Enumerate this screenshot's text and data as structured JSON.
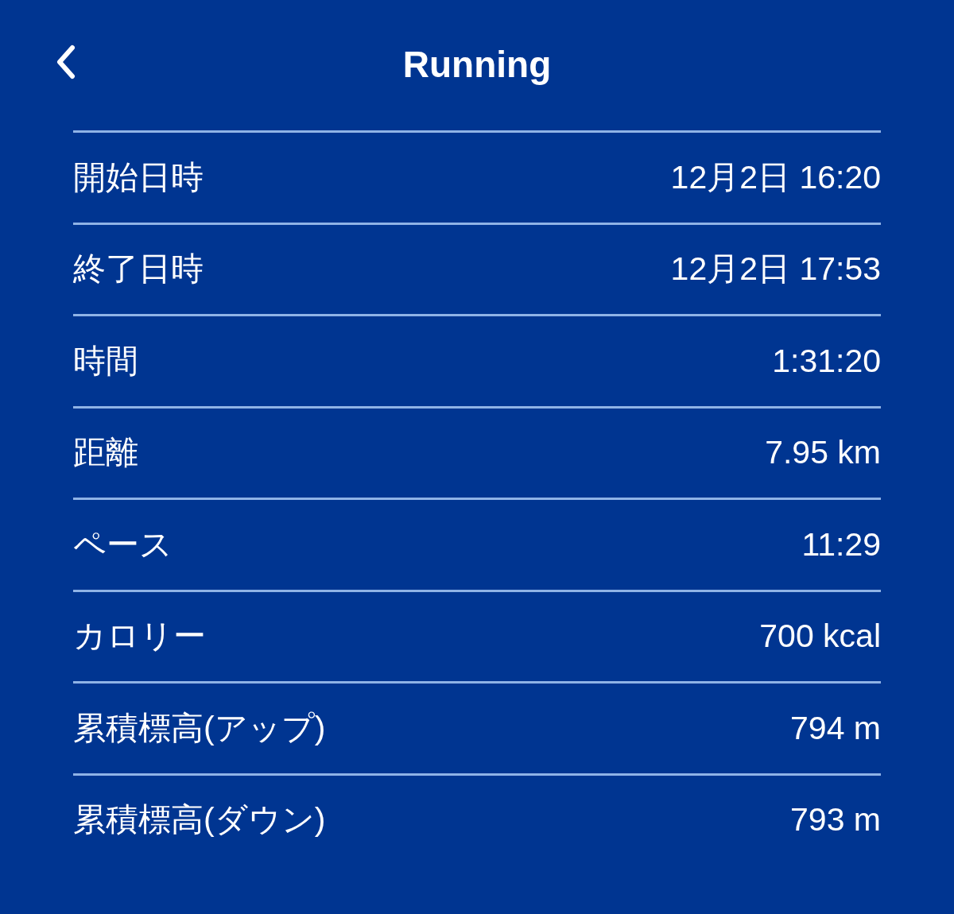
{
  "header": {
    "title": "Running"
  },
  "rows": [
    {
      "label": "開始日時",
      "value": "12月2日 16:20"
    },
    {
      "label": "終了日時",
      "value": "12月2日 17:53"
    },
    {
      "label": "時間",
      "value": "1:31:20"
    },
    {
      "label": "距離",
      "value": "7.95 km"
    },
    {
      "label": "ペース",
      "value": "11:29"
    },
    {
      "label": "カロリー",
      "value": "700 kcal"
    },
    {
      "label": "累積標高(アップ)",
      "value": "794 m"
    },
    {
      "label": "累積標高(ダウン)",
      "value": "793 m"
    }
  ]
}
